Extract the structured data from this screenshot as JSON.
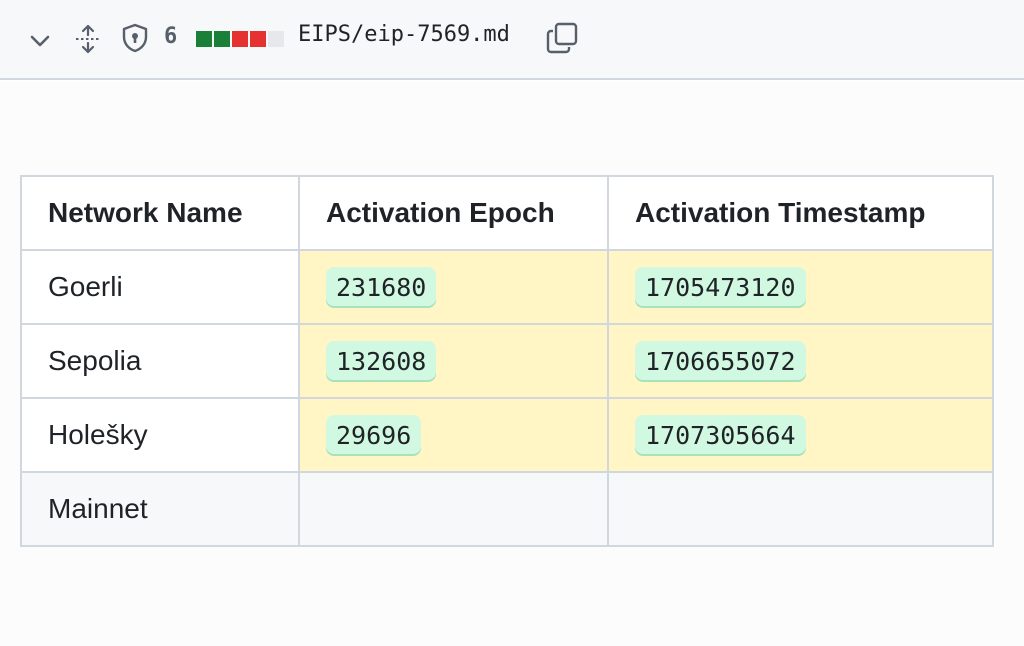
{
  "header": {
    "chevron_icon": "chevron-down-icon",
    "expand_icon": "unfold-icon",
    "shield_icon": "shield-lock-icon",
    "changes_count": "6",
    "diffstat": [
      "added",
      "added",
      "deleted",
      "deleted",
      "neutral"
    ],
    "diffstat_colors": {
      "added": "#1a7f37",
      "deleted": "#e5312f",
      "neutral": "#e6e8eb"
    },
    "filename": "EIPS/eip-7569.md",
    "copy_icon": "copy-icon"
  },
  "expander": {
    "icon": "unfold-icon"
  },
  "table": {
    "headers": [
      "Network Name",
      "Activation Epoch",
      "Activation Timestamp"
    ],
    "rows": [
      {
        "network": "Goerli",
        "epoch": "231680",
        "timestamp": "1705473120"
      },
      {
        "network": "Sepolia",
        "epoch": "132608",
        "timestamp": "1706655072"
      },
      {
        "network": "Holešky",
        "epoch": "29696",
        "timestamp": "1707305664"
      },
      {
        "network": "Mainnet",
        "epoch": "",
        "timestamp": ""
      }
    ]
  },
  "colors": {
    "changed_cell": "#fff5c5",
    "code_bg": "#d1f8e1",
    "border": "#d0d7de"
  }
}
